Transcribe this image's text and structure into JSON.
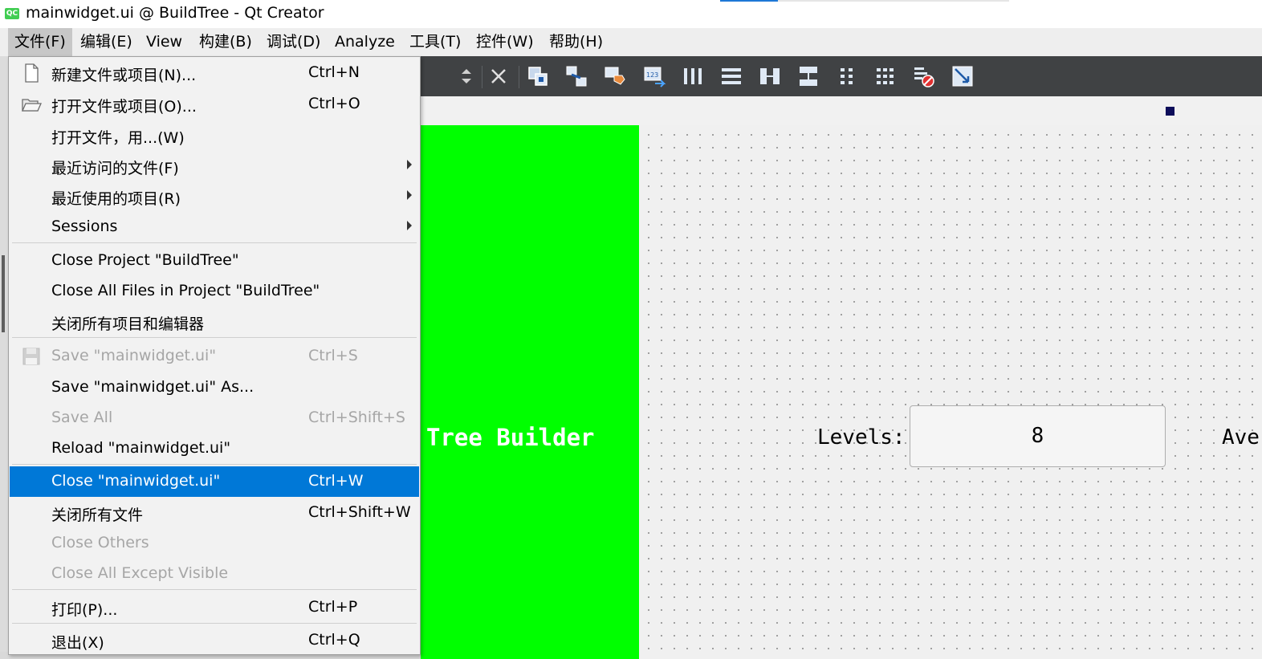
{
  "window": {
    "app_icon": "QC",
    "title": "mainwidget.ui @ BuildTree - Qt Creator"
  },
  "menubar": {
    "items": [
      "文件(F)",
      "编辑(E)",
      "View",
      "构建(B)",
      "调试(D)",
      "Analyze",
      "工具(T)",
      "控件(W)",
      "帮助(H)"
    ],
    "open_index": 0
  },
  "toolbar": {
    "icons": [
      "spin-arrows-icon",
      "break-layout-icon",
      "edit-widgets-icon",
      "edit-signals-slots-icon",
      "edit-buddies-icon",
      "edit-tab-order-icon",
      "layout-horizontal-icon",
      "layout-vertical-icon",
      "layout-horizontal-splitter-icon",
      "layout-vertical-splitter-icon",
      "layout-form-icon",
      "layout-grid-icon",
      "break-layout-red-icon",
      "adjust-size-icon"
    ]
  },
  "file_menu": {
    "items": [
      {
        "label": "新建文件或项目(N)...",
        "shortcut": "Ctrl+N",
        "icon": "new-file-icon"
      },
      {
        "label": "打开文件或项目(O)...",
        "shortcut": "Ctrl+O",
        "icon": "open-folder-icon"
      },
      {
        "label": "打开文件，用...(W)",
        "shortcut": ""
      },
      {
        "label": "最近访问的文件(F)",
        "shortcut": "",
        "submenu": true
      },
      {
        "label": "最近使用的项目(R)",
        "shortcut": "",
        "submenu": true
      },
      {
        "label": "Sessions",
        "shortcut": "",
        "submenu": true
      },
      {
        "label": "Close Project \"BuildTree\"",
        "shortcut": ""
      },
      {
        "label": "Close All Files in Project \"BuildTree\"",
        "shortcut": ""
      },
      {
        "label": "关闭所有项目和编辑器",
        "shortcut": ""
      },
      {
        "label": "Save \"mainwidget.ui\"",
        "shortcut": "Ctrl+S",
        "disabled": true,
        "icon": "save-disk-icon"
      },
      {
        "label": "Save \"mainwidget.ui\" As...",
        "shortcut": ""
      },
      {
        "label": "Save All",
        "shortcut": "Ctrl+Shift+S",
        "disabled": true
      },
      {
        "label": "Reload \"mainwidget.ui\"",
        "shortcut": ""
      },
      {
        "label": "Close \"mainwidget.ui\"",
        "shortcut": "Ctrl+W",
        "highlighted": true
      },
      {
        "label": "关闭所有文件",
        "shortcut": "Ctrl+Shift+W"
      },
      {
        "label": "Close Others",
        "shortcut": "",
        "disabled": true
      },
      {
        "label": "Close All Except Visible",
        "shortcut": "",
        "disabled": true
      },
      {
        "label": "打印(P)...",
        "shortcut": "Ctrl+P"
      },
      {
        "label": "退出(X)",
        "shortcut": "Ctrl+Q"
      }
    ]
  },
  "form": {
    "title_label": "Tree Builder",
    "levels_label": "Levels:",
    "levels_value": "8",
    "ave_label": "Ave",
    "panel_color": "#00ff00"
  },
  "colors": {
    "highlight": "#0078d7",
    "toolbar_bg": "#404244",
    "disabled_text": "#a6a6a6"
  }
}
